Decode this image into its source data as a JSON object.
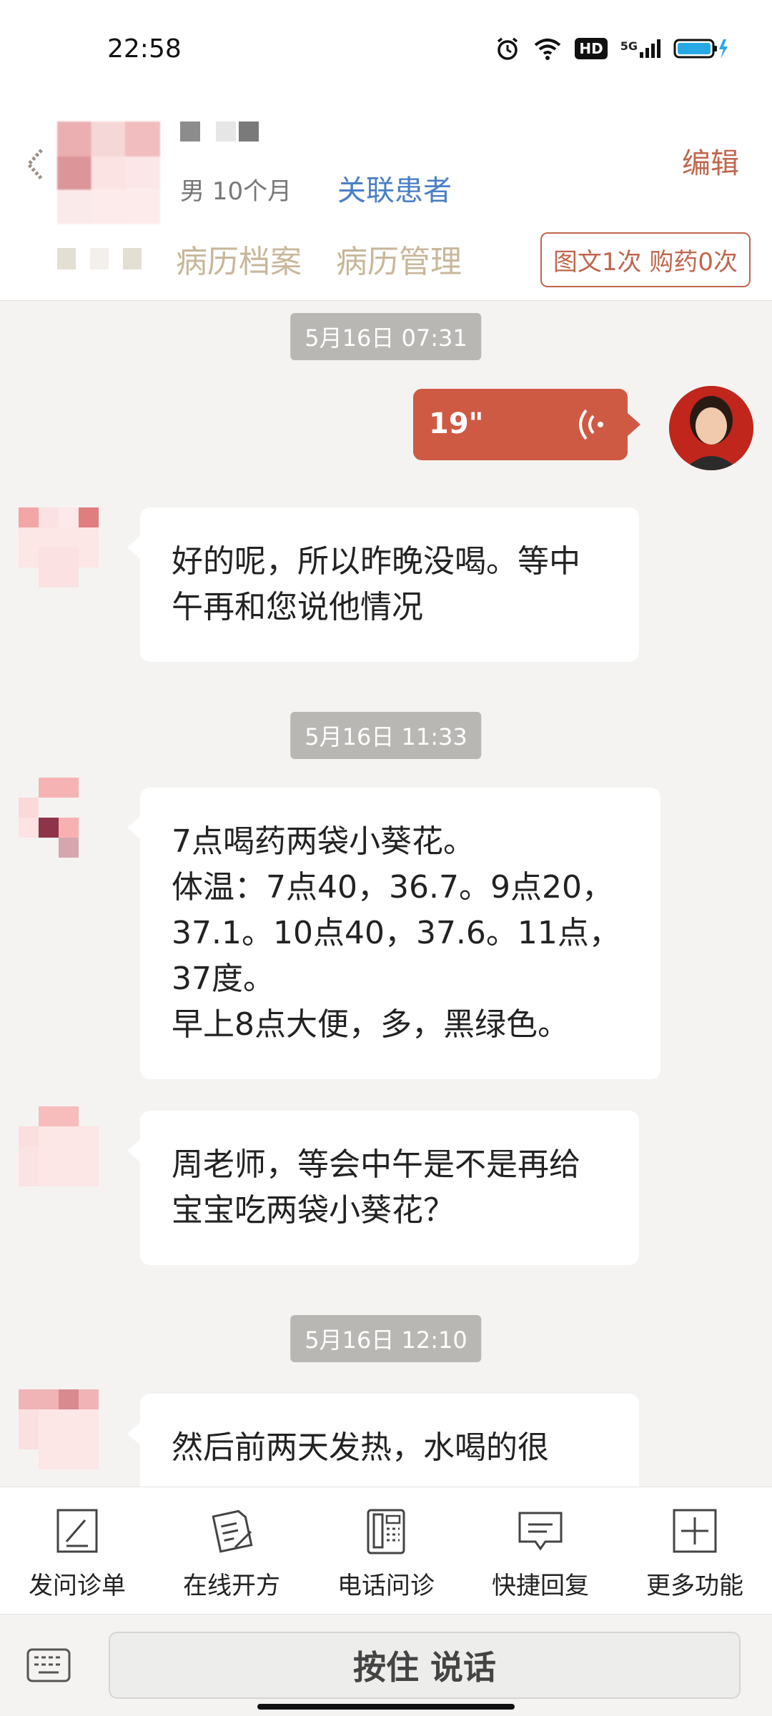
{
  "status_bar": {
    "time": "22:58",
    "hd": "HD",
    "net": "5G"
  },
  "header": {
    "gender_age": "男 10个月",
    "link_patient": "关联患者",
    "edit": "编辑",
    "tabs": [
      "病历档案",
      "病历管理"
    ],
    "counter": "图文1次 购药0次"
  },
  "chat": {
    "timestamps": [
      "5月16日 07:31",
      "5月16日 11:33",
      "5月16日 12:10"
    ],
    "voice_duration": "19\"",
    "messages": [
      "好的呢，所以昨晚没喝。等中\n午再和您说他情况",
      "7点喝药两袋小葵花。\n体温：7点40，36.7。9点20，\n37.1。10点40，37.6。11点，\n37度。\n早上8点大便，多，黑绿色。",
      "周老师，等会中午是不是再给\n宝宝吃两袋小葵花？",
      "然后前两天发热，水喝的很"
    ]
  },
  "toolbar": {
    "items": [
      {
        "label": "发问诊单",
        "icon": "form-icon"
      },
      {
        "label": "在线开方",
        "icon": "prescription-icon"
      },
      {
        "label": "电话问诊",
        "icon": "phone-icon"
      },
      {
        "label": "快捷回复",
        "icon": "quick-reply-icon"
      },
      {
        "label": "更多功能",
        "icon": "plus-icon"
      }
    ]
  },
  "input": {
    "push_to_talk": "按住 说话"
  },
  "colors": {
    "accent": "#cf5a43",
    "link": "#4a7fc5",
    "tab": "#c9b79a"
  }
}
